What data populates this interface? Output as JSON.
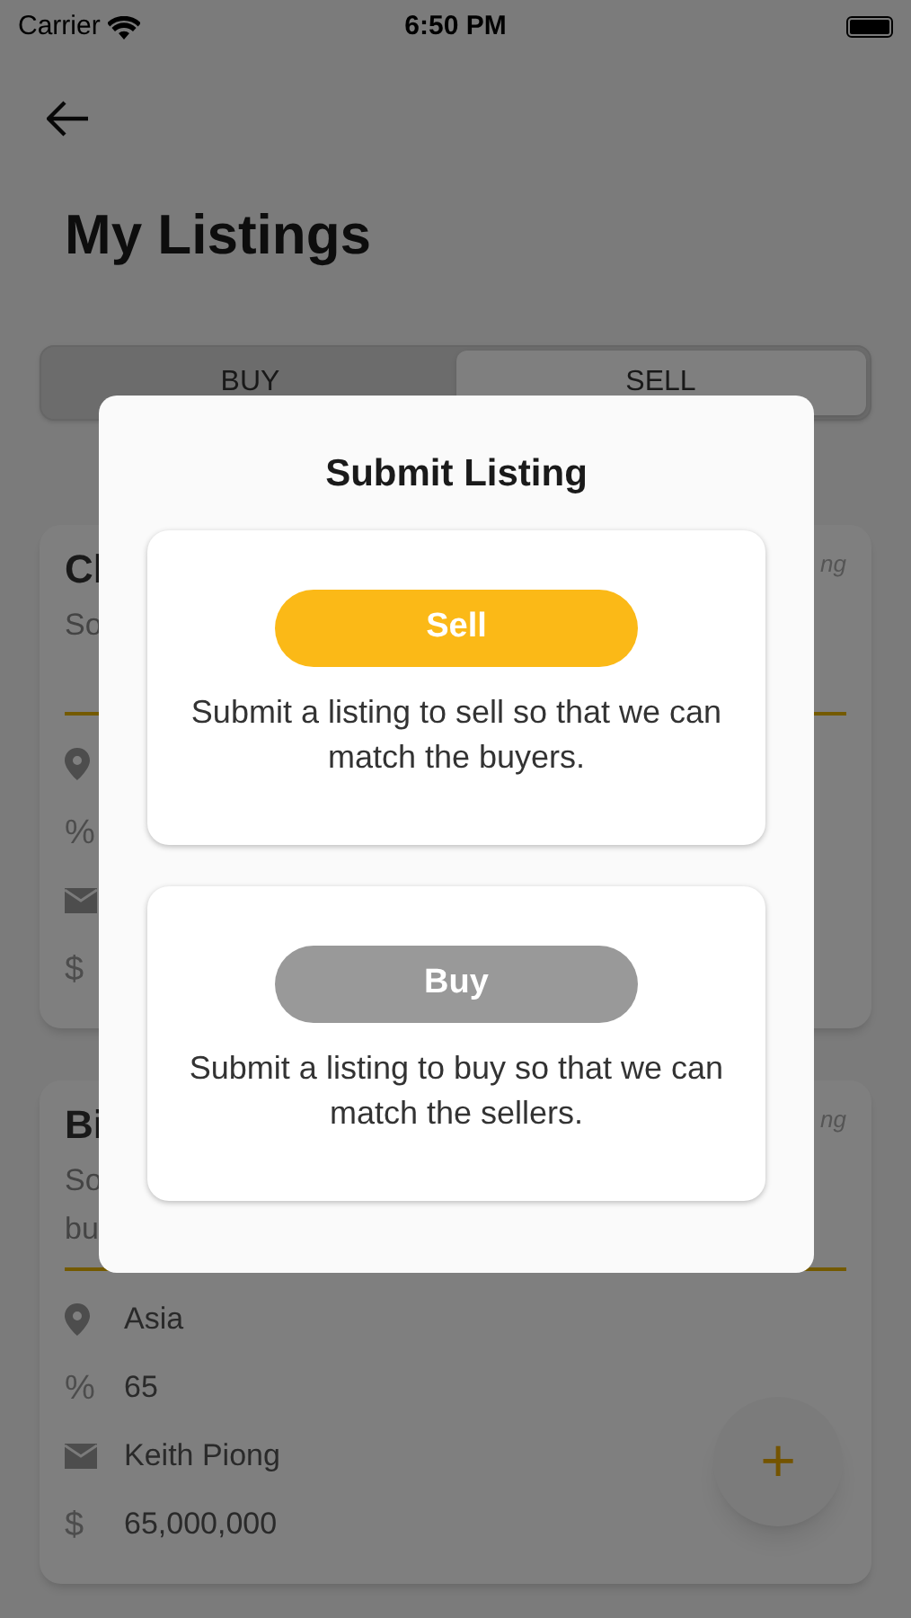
{
  "status_bar": {
    "carrier": "Carrier",
    "time": "6:50 PM"
  },
  "header": {
    "title": "My Listings"
  },
  "tabs": [
    {
      "label": "BUY",
      "selected": false
    },
    {
      "label": "SELL",
      "selected": true
    }
  ],
  "listings": [
    {
      "title": "Cl",
      "tag": "ng",
      "description": [
        "So"
      ],
      "details": [
        {
          "kind": "location"
        },
        {
          "kind": "glyph",
          "glyph": "%"
        },
        {
          "kind": "mail"
        },
        {
          "kind": "glyph",
          "glyph": "$"
        }
      ]
    },
    {
      "title": "Bi",
      "tag": "ng",
      "description": [
        "So",
        "bu"
      ],
      "details": [
        {
          "kind": "location",
          "text": "Asia"
        },
        {
          "kind": "glyph",
          "glyph": "%",
          "text": "65"
        },
        {
          "kind": "mail",
          "text": "Keith Piong"
        },
        {
          "kind": "glyph",
          "glyph": "$",
          "text": "65,000,000"
        }
      ]
    }
  ],
  "fab": {
    "label": "+"
  },
  "dialog": {
    "title": "Submit Listing",
    "options": [
      {
        "kind": "sell",
        "button": "Sell",
        "description": "Submit a listing to sell so that we can match the buyers."
      },
      {
        "kind": "buy",
        "button": "Buy",
        "description": "Submit a listing to buy so that we can match the sellers."
      }
    ]
  }
}
